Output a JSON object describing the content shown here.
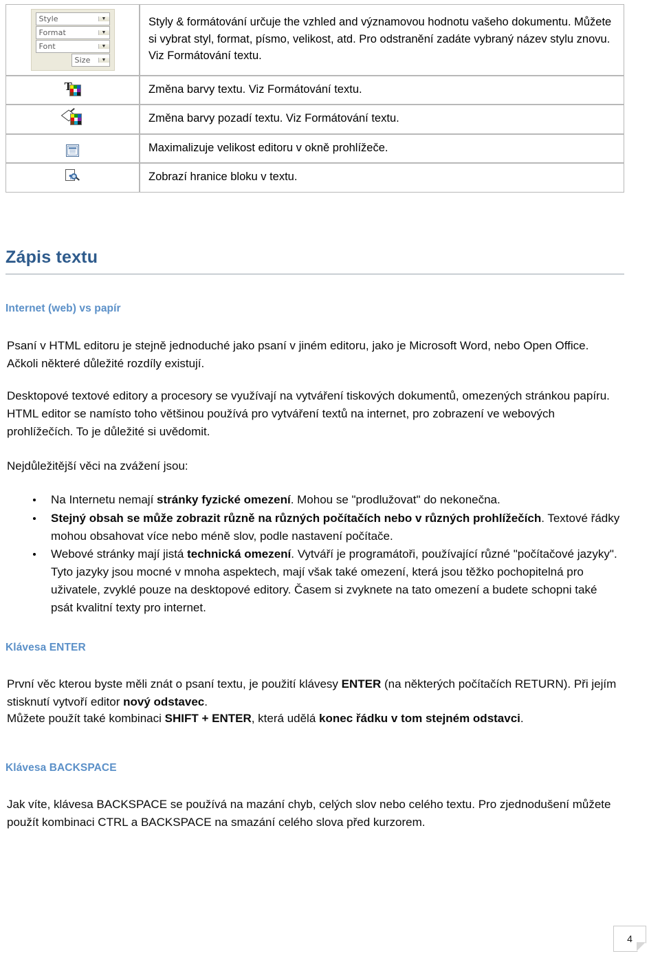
{
  "document": {
    "page_number": "4"
  },
  "reference_table": {
    "rows": [
      {
        "icon": "style-format-font-size-dropdowns",
        "controls": [
          {
            "label": "Style"
          },
          {
            "label": "Format"
          },
          {
            "label": "Font"
          },
          {
            "label": "Size"
          }
        ],
        "description": "Styly & formátování určuje the vzhled and významovou hodnotu vašeho dokumentu. Můžete si vybrat styl, format, písmo, velikost, atd. Pro odstranění zadáte vybraný název stylu znovu. Viz Formátování textu."
      },
      {
        "icon": "text-color-icon",
        "description": "Změna barvy textu. Viz Formátování textu."
      },
      {
        "icon": "background-color-icon",
        "description": "Změna barvy pozadí textu. Viz Formátování textu."
      },
      {
        "icon": "maximize-editor-icon",
        "description": "Maximalizuje velikost editoru v okně prohlížeče."
      },
      {
        "icon": "show-block-boundaries-icon",
        "description": "Zobrazí hranice bloku v textu."
      }
    ]
  },
  "sections": {
    "main_heading": "Zápis textu",
    "subheading_1": "Internet (web) vs papír",
    "paragraph_1": "Psaní v HTML editoru je stejně jednoduché jako psaní v jiném editoru, jako je Microsoft Word, nebo Open Office. Ačkoli některé důležité rozdíly existují.",
    "paragraph_2": "Desktopové textové editory a procesory se využívají na vytváření tiskových dokumentů, omezených stránkou papíru. HTML editor se namísto toho většinou používá pro vytváření textů na internet, pro zobrazení ve webových prohlížečích. To je důležité si uvědomit.",
    "paragraph_3": "Nejdůležitější věci na zvážení jsou:",
    "bullets": [
      {
        "parts": [
          {
            "text": "Na Internetu nemají ",
            "bold": false
          },
          {
            "text": "stránky fyzické omezení",
            "bold": true
          },
          {
            "text": ". Mohou se \"prodlužovat\" do nekonečna.",
            "bold": false
          }
        ]
      },
      {
        "parts": [
          {
            "text": "Stejný obsah se může zobrazit různě na různých počítačích nebo v různých prohlížečích",
            "bold": true
          },
          {
            "text": ". Textové řádky mohou obsahovat více nebo méně slov, podle nastavení počítače.",
            "bold": false
          }
        ]
      },
      {
        "parts": [
          {
            "text": "Webové stránky mají jistá ",
            "bold": false
          },
          {
            "text": "technická omezení",
            "bold": true
          },
          {
            "text": ". Vytváří je programátoři, používající různé \"počítačové jazyky\". Tyto jazyky jsou mocné v mnoha aspektech, mají však také omezení, která jsou těžko pochopitelná pro uživatele, zvyklé pouze na desktopové editory. Časem si zvyknete na tato omezení a budete schopni také psát kvalitní texty pro internet.",
            "bold": false
          }
        ]
      }
    ],
    "subheading_2": "Klávesa ENTER",
    "enter_paragraph": [
      {
        "text": "První věc kterou byste měli znát o psaní textu, je použití klávesy ",
        "bold": false
      },
      {
        "text": "ENTER",
        "bold": true
      },
      {
        "text": " (na některých počítačích RETURN). Při jejím stisknutí vytvoří editor ",
        "bold": false
      },
      {
        "text": "nový odstavec",
        "bold": true
      },
      {
        "text": ".",
        "bold": false
      }
    ],
    "enter_paragraph_2": [
      {
        "text": "Můžete použít také kombinaci ",
        "bold": false
      },
      {
        "text": "SHIFT + ENTER",
        "bold": true
      },
      {
        "text": ", která udělá ",
        "bold": false
      },
      {
        "text": "konec řádku v tom stejném odstavci",
        "bold": true
      },
      {
        "text": ".",
        "bold": false
      }
    ],
    "subheading_3": "Klávesa BACKSPACE",
    "backspace_paragraph": "Jak víte, klávesa BACKSPACE se používá na mazání chyb, celých slov nebo celého textu. Pro zjednodušení můžete použít kombinaci CTRL a BACKSPACE na smazání celého slova před kurzorem."
  },
  "colors": {
    "heading_primary": "#2e5b8c",
    "heading_secondary": "#5b90c8",
    "body_text": "#0b0b0b",
    "table_border": "#b8b8b8",
    "toolbar_bg": "#eceadc"
  }
}
